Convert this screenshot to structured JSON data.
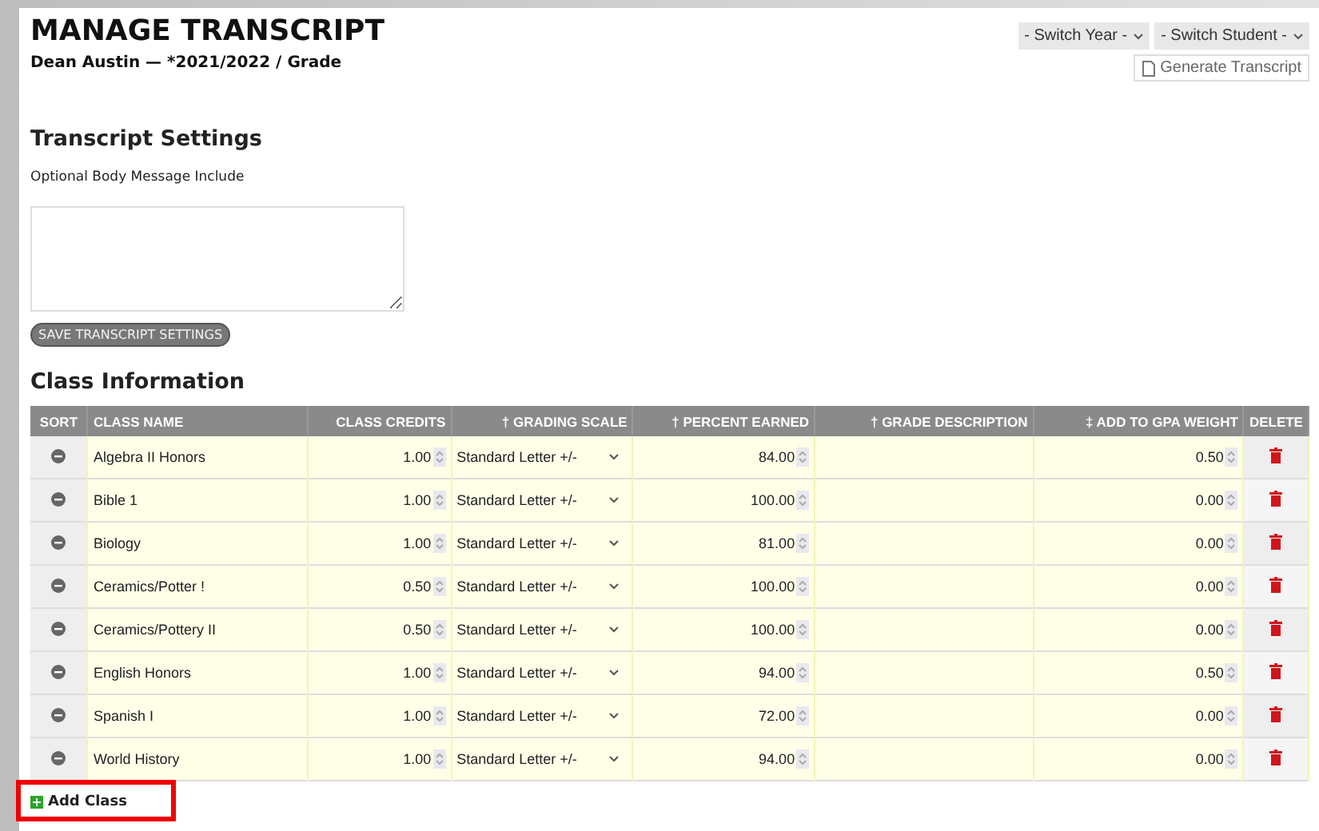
{
  "title": "MANAGE TRANSCRIPT",
  "subtitle": "Dean Austin — *2021/2022 / Grade",
  "selects": [
    "- Switch Year -",
    "- Switch Student -"
  ],
  "generate_button": "Generate Transcript",
  "settings": {
    "heading": "Transcript Settings",
    "label": "Optional Body Message Include",
    "save_button": "SAVE TRANSCRIPT SETTINGS"
  },
  "class_heading": "Class Information",
  "table": {
    "columns": [
      "SORT",
      "CLASS NAME",
      "CLASS CREDITS",
      "† GRADING SCALE",
      "† PERCENT EARNED",
      "† GRADE DESCRIPTION",
      "‡ ADD TO GPA WEIGHT",
      "DELETE"
    ],
    "rows": [
      {
        "name": "Algebra II Honors",
        "credits": "1.00",
        "scale": "Standard Letter +/-",
        "percent": "84.00",
        "gpa": "0.50"
      },
      {
        "name": "Bible 1",
        "credits": "1.00",
        "scale": "Standard Letter +/-",
        "percent": "100.00",
        "gpa": "0.00"
      },
      {
        "name": "Biology",
        "credits": "1.00",
        "scale": "Standard Letter +/-",
        "percent": "81.00",
        "gpa": "0.00"
      },
      {
        "name": "Ceramics/Potter !",
        "credits": "0.50",
        "scale": "Standard Letter +/-",
        "percent": "100.00",
        "gpa": "0.00"
      },
      {
        "name": "Ceramics/Pottery II",
        "credits": "0.50",
        "scale": "Standard Letter +/-",
        "percent": "100.00",
        "gpa": "0.00"
      },
      {
        "name": "English Honors",
        "credits": "1.00",
        "scale": "Standard Letter +/-",
        "percent": "94.00",
        "gpa": "0.50"
      },
      {
        "name": "Spanish I",
        "credits": "1.00",
        "scale": "Standard Letter +/-",
        "percent": "72.00",
        "gpa": "0.00"
      },
      {
        "name": "World History",
        "credits": "1.00",
        "scale": "Standard Letter +/-",
        "percent": "94.00",
        "gpa": "0.00"
      }
    ]
  },
  "add_class": "Add Class"
}
